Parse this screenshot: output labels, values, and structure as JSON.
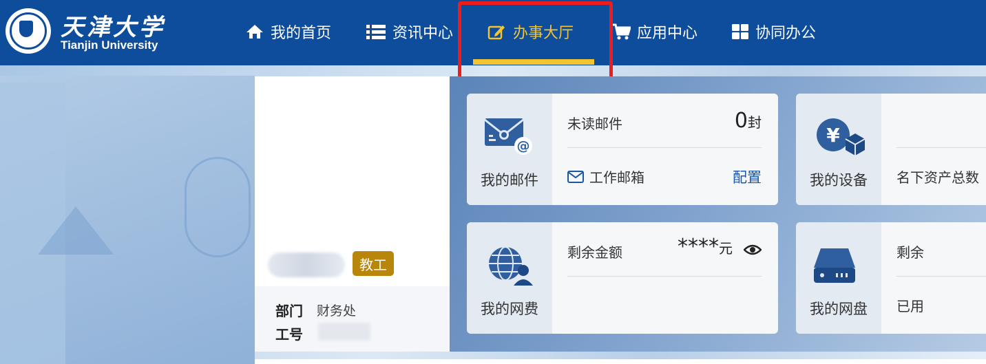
{
  "header": {
    "logo_cn": "天津大学",
    "logo_en": "Tianjin University",
    "nav": [
      {
        "label": "我的首页",
        "icon": "home-icon"
      },
      {
        "label": "资讯中心",
        "icon": "list-icon"
      },
      {
        "label": "办事大厅",
        "icon": "edit-icon",
        "active": true
      },
      {
        "label": "应用中心",
        "icon": "cart-icon"
      },
      {
        "label": "协同办公",
        "icon": "grid-icon"
      }
    ],
    "accent_color": "#f4c430",
    "bar_color": "#0e4d9c"
  },
  "profile": {
    "role_badge": "教工",
    "dept_label": "部门",
    "dept_value": "财务处",
    "id_label": "工号"
  },
  "cards": {
    "mail": {
      "title": "我的邮件",
      "stat_label": "未读邮件",
      "stat_value": "0",
      "stat_unit": "封",
      "link_label": "工作邮箱",
      "action": "配置"
    },
    "device": {
      "title": "我的设备",
      "stat_label": "名下资产总数"
    },
    "net": {
      "title": "我的网费",
      "stat_label": "剩余金额",
      "stat_value": "****",
      "stat_unit": "元"
    },
    "disk": {
      "title": "我的网盘",
      "stat_label": "剩余",
      "used_label": "已用"
    }
  }
}
